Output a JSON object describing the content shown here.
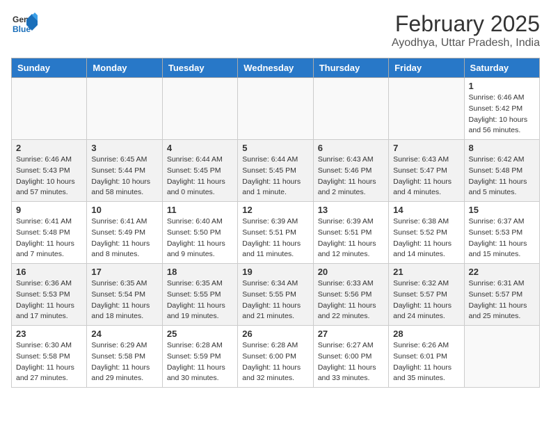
{
  "header": {
    "logo_general": "General",
    "logo_blue": "Blue",
    "month_title": "February 2025",
    "location": "Ayodhya, Uttar Pradesh, India"
  },
  "weekdays": [
    "Sunday",
    "Monday",
    "Tuesday",
    "Wednesday",
    "Thursday",
    "Friday",
    "Saturday"
  ],
  "weeks": [
    [
      {
        "day": "",
        "info": ""
      },
      {
        "day": "",
        "info": ""
      },
      {
        "day": "",
        "info": ""
      },
      {
        "day": "",
        "info": ""
      },
      {
        "day": "",
        "info": ""
      },
      {
        "day": "",
        "info": ""
      },
      {
        "day": "1",
        "info": "Sunrise: 6:46 AM\nSunset: 5:42 PM\nDaylight: 10 hours\nand 56 minutes."
      }
    ],
    [
      {
        "day": "2",
        "info": "Sunrise: 6:46 AM\nSunset: 5:43 PM\nDaylight: 10 hours\nand 57 minutes."
      },
      {
        "day": "3",
        "info": "Sunrise: 6:45 AM\nSunset: 5:44 PM\nDaylight: 10 hours\nand 58 minutes."
      },
      {
        "day": "4",
        "info": "Sunrise: 6:44 AM\nSunset: 5:45 PM\nDaylight: 11 hours\nand 0 minutes."
      },
      {
        "day": "5",
        "info": "Sunrise: 6:44 AM\nSunset: 5:45 PM\nDaylight: 11 hours\nand 1 minute."
      },
      {
        "day": "6",
        "info": "Sunrise: 6:43 AM\nSunset: 5:46 PM\nDaylight: 11 hours\nand 2 minutes."
      },
      {
        "day": "7",
        "info": "Sunrise: 6:43 AM\nSunset: 5:47 PM\nDaylight: 11 hours\nand 4 minutes."
      },
      {
        "day": "8",
        "info": "Sunrise: 6:42 AM\nSunset: 5:48 PM\nDaylight: 11 hours\nand 5 minutes."
      }
    ],
    [
      {
        "day": "9",
        "info": "Sunrise: 6:41 AM\nSunset: 5:48 PM\nDaylight: 11 hours\nand 7 minutes."
      },
      {
        "day": "10",
        "info": "Sunrise: 6:41 AM\nSunset: 5:49 PM\nDaylight: 11 hours\nand 8 minutes."
      },
      {
        "day": "11",
        "info": "Sunrise: 6:40 AM\nSunset: 5:50 PM\nDaylight: 11 hours\nand 9 minutes."
      },
      {
        "day": "12",
        "info": "Sunrise: 6:39 AM\nSunset: 5:51 PM\nDaylight: 11 hours\nand 11 minutes."
      },
      {
        "day": "13",
        "info": "Sunrise: 6:39 AM\nSunset: 5:51 PM\nDaylight: 11 hours\nand 12 minutes."
      },
      {
        "day": "14",
        "info": "Sunrise: 6:38 AM\nSunset: 5:52 PM\nDaylight: 11 hours\nand 14 minutes."
      },
      {
        "day": "15",
        "info": "Sunrise: 6:37 AM\nSunset: 5:53 PM\nDaylight: 11 hours\nand 15 minutes."
      }
    ],
    [
      {
        "day": "16",
        "info": "Sunrise: 6:36 AM\nSunset: 5:53 PM\nDaylight: 11 hours\nand 17 minutes."
      },
      {
        "day": "17",
        "info": "Sunrise: 6:35 AM\nSunset: 5:54 PM\nDaylight: 11 hours\nand 18 minutes."
      },
      {
        "day": "18",
        "info": "Sunrise: 6:35 AM\nSunset: 5:55 PM\nDaylight: 11 hours\nand 19 minutes."
      },
      {
        "day": "19",
        "info": "Sunrise: 6:34 AM\nSunset: 5:55 PM\nDaylight: 11 hours\nand 21 minutes."
      },
      {
        "day": "20",
        "info": "Sunrise: 6:33 AM\nSunset: 5:56 PM\nDaylight: 11 hours\nand 22 minutes."
      },
      {
        "day": "21",
        "info": "Sunrise: 6:32 AM\nSunset: 5:57 PM\nDaylight: 11 hours\nand 24 minutes."
      },
      {
        "day": "22",
        "info": "Sunrise: 6:31 AM\nSunset: 5:57 PM\nDaylight: 11 hours\nand 25 minutes."
      }
    ],
    [
      {
        "day": "23",
        "info": "Sunrise: 6:30 AM\nSunset: 5:58 PM\nDaylight: 11 hours\nand 27 minutes."
      },
      {
        "day": "24",
        "info": "Sunrise: 6:29 AM\nSunset: 5:58 PM\nDaylight: 11 hours\nand 29 minutes."
      },
      {
        "day": "25",
        "info": "Sunrise: 6:28 AM\nSunset: 5:59 PM\nDaylight: 11 hours\nand 30 minutes."
      },
      {
        "day": "26",
        "info": "Sunrise: 6:28 AM\nSunset: 6:00 PM\nDaylight: 11 hours\nand 32 minutes."
      },
      {
        "day": "27",
        "info": "Sunrise: 6:27 AM\nSunset: 6:00 PM\nDaylight: 11 hours\nand 33 minutes."
      },
      {
        "day": "28",
        "info": "Sunrise: 6:26 AM\nSunset: 6:01 PM\nDaylight: 11 hours\nand 35 minutes."
      },
      {
        "day": "",
        "info": ""
      }
    ]
  ]
}
